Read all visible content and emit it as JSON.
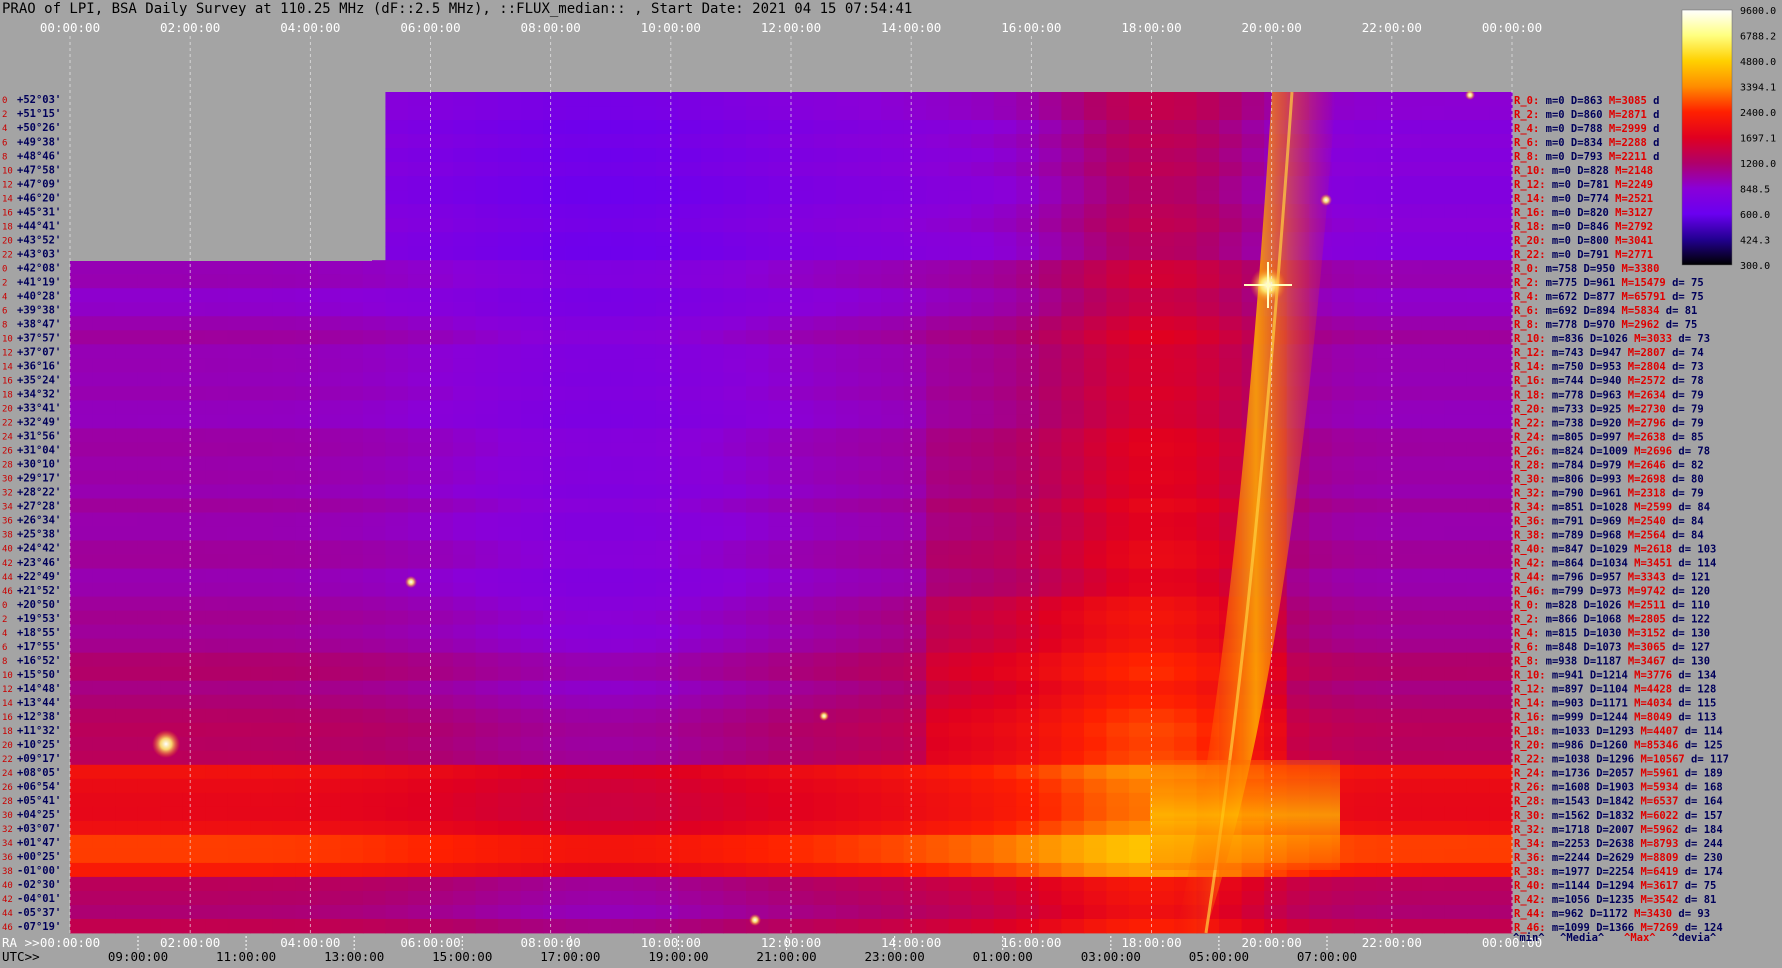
{
  "title": "PRAO of LPI, BSA Daily Survey at 110.25 MHz (dF::2.5 MHz), ::FLUX_median:: , Start Date: 2021 04 15 07:54:41",
  "chart_data": {
    "type": "heatmap",
    "x_top_ticks": [
      "00:00:00",
      "02:00:00",
      "04:00:00",
      "06:00:00",
      "08:00:00",
      "10:00:00",
      "12:00:00",
      "14:00:00",
      "16:00:00",
      "18:00:00",
      "20:00:00",
      "22:00:00",
      "00:00:00"
    ],
    "x_bottom_ra_label": "RA >>",
    "x_bottom_ra_ticks": [
      "00:00:00",
      "02:00:00",
      "04:00:00",
      "06:00:00",
      "08:00:00",
      "10:00:00",
      "12:00:00",
      "14:00:00",
      "16:00:00",
      "18:00:00",
      "20:00:00",
      "22:00:00",
      "00:00:00"
    ],
    "x_bottom_utc_label": "UTC>>",
    "x_bottom_utc_ticks": [
      "09:00:00",
      "11:00:00",
      "13:00:00",
      "15:00:00",
      "17:00:00",
      "19:00:00",
      "21:00:00",
      "23:00:00",
      "01:00:00",
      "03:00:00",
      "05:00:00",
      "07:00:00"
    ],
    "colorbar": {
      "ticks": [
        "9600.0",
        "6788.2",
        "4800.0",
        "3394.1",
        "2400.0",
        "1697.1",
        "1200.0",
        "848.5",
        "600.0",
        "424.3",
        "300.0"
      ],
      "colors": [
        "#ffffff",
        "#ffff80",
        "#ffd000",
        "#ff8c00",
        "#ff2000",
        "#e00020",
        "#b0006a",
        "#8a00d8",
        "#6a00f0",
        "#220090",
        "#000000"
      ]
    },
    "rows": [
      {
        "i": "0",
        "dec": "+52°03'",
        "r": "R_0:",
        "m": "0",
        "d": "863",
        "mx": "3085",
        "dev": "d"
      },
      {
        "i": "2",
        "dec": "+51°15'",
        "r": "R_2:",
        "m": "0",
        "d": "860",
        "mx": "2871",
        "dev": "d"
      },
      {
        "i": "4",
        "dec": "+50°26'",
        "r": "R_4:",
        "m": "0",
        "d": "788",
        "mx": "2999",
        "dev": "d"
      },
      {
        "i": "6",
        "dec": "+49°38'",
        "r": "R_6:",
        "m": "0",
        "d": "834",
        "mx": "2288",
        "dev": "d"
      },
      {
        "i": "8",
        "dec": "+48°46'",
        "r": "R_8:",
        "m": "0",
        "d": "793",
        "mx": "2211",
        "dev": "d"
      },
      {
        "i": "10",
        "dec": "+47°58'",
        "r": "R_10:",
        "m": "0",
        "d": "828",
        "mx": "2148",
        "dev": ""
      },
      {
        "i": "12",
        "dec": "+47°09'",
        "r": "R_12:",
        "m": "0",
        "d": "781",
        "mx": "2249",
        "dev": ""
      },
      {
        "i": "14",
        "dec": "+46°20'",
        "r": "R_14:",
        "m": "0",
        "d": "774",
        "mx": "2521",
        "dev": ""
      },
      {
        "i": "16",
        "dec": "+45°31'",
        "r": "R_16:",
        "m": "0",
        "d": "820",
        "mx": "3127",
        "dev": ""
      },
      {
        "i": "18",
        "dec": "+44°41'",
        "r": "R_18:",
        "m": "0",
        "d": "846",
        "mx": "2792",
        "dev": ""
      },
      {
        "i": "20",
        "dec": "+43°52'",
        "r": "R_20:",
        "m": "0",
        "d": "800",
        "mx": "3041",
        "dev": ""
      },
      {
        "i": "22",
        "dec": "+43°03'",
        "r": "R_22:",
        "m": "0",
        "d": "791",
        "mx": "2771",
        "dev": ""
      },
      {
        "i": "0",
        "dec": "+42°08'",
        "r": "R_0:",
        "m": "758",
        "d": "950",
        "mx": "3380",
        "dev": ""
      },
      {
        "i": "2",
        "dec": "+41°19'",
        "r": "R_2:",
        "m": "775",
        "d": "961",
        "mx": "15479",
        "dev": "75"
      },
      {
        "i": "4",
        "dec": "+40°28'",
        "r": "R_4:",
        "m": "672",
        "d": "877",
        "mx": "65791",
        "dev": "75"
      },
      {
        "i": "6",
        "dec": "+39°38'",
        "r": "R_6:",
        "m": "692",
        "d": "894",
        "mx": "5834",
        "dev": "81"
      },
      {
        "i": "8",
        "dec": "+38°47'",
        "r": "R_8:",
        "m": "778",
        "d": "970",
        "mx": "2962",
        "dev": "75"
      },
      {
        "i": "10",
        "dec": "+37°57'",
        "r": "R_10:",
        "m": "836",
        "d": "1026",
        "mx": "3033",
        "dev": "73"
      },
      {
        "i": "12",
        "dec": "+37°07'",
        "r": "R_12:",
        "m": "743",
        "d": "947",
        "mx": "2807",
        "dev": "74"
      },
      {
        "i": "14",
        "dec": "+36°16'",
        "r": "R_14:",
        "m": "750",
        "d": "953",
        "mx": "2804",
        "dev": "73"
      },
      {
        "i": "16",
        "dec": "+35°24'",
        "r": "R_16:",
        "m": "744",
        "d": "940",
        "mx": "2572",
        "dev": "78"
      },
      {
        "i": "18",
        "dec": "+34°32'",
        "r": "R_18:",
        "m": "778",
        "d": "963",
        "mx": "2634",
        "dev": "79"
      },
      {
        "i": "20",
        "dec": "+33°41'",
        "r": "R_20:",
        "m": "733",
        "d": "925",
        "mx": "2730",
        "dev": "79"
      },
      {
        "i": "22",
        "dec": "+32°49'",
        "r": "R_22:",
        "m": "738",
        "d": "920",
        "mx": "2796",
        "dev": "79"
      },
      {
        "i": "24",
        "dec": "+31°56'",
        "r": "R_24:",
        "m": "805",
        "d": "997",
        "mx": "2638",
        "dev": "85"
      },
      {
        "i": "26",
        "dec": "+31°04'",
        "r": "R_26:",
        "m": "824",
        "d": "1009",
        "mx": "2696",
        "dev": "78"
      },
      {
        "i": "28",
        "dec": "+30°10'",
        "r": "R_28:",
        "m": "784",
        "d": "979",
        "mx": "2646",
        "dev": "82"
      },
      {
        "i": "30",
        "dec": "+29°17'",
        "r": "R_30:",
        "m": "806",
        "d": "993",
        "mx": "2698",
        "dev": "80"
      },
      {
        "i": "32",
        "dec": "+28°22'",
        "r": "R_32:",
        "m": "790",
        "d": "961",
        "mx": "2318",
        "dev": "79"
      },
      {
        "i": "34",
        "dec": "+27°28'",
        "r": "R_34:",
        "m": "851",
        "d": "1028",
        "mx": "2599",
        "dev": "84"
      },
      {
        "i": "36",
        "dec": "+26°34'",
        "r": "R_36:",
        "m": "791",
        "d": "969",
        "mx": "2540",
        "dev": "84"
      },
      {
        "i": "38",
        "dec": "+25°38'",
        "r": "R_38:",
        "m": "789",
        "d": "968",
        "mx": "2564",
        "dev": "84"
      },
      {
        "i": "40",
        "dec": "+24°42'",
        "r": "R_40:",
        "m": "847",
        "d": "1029",
        "mx": "2618",
        "dev": "103"
      },
      {
        "i": "42",
        "dec": "+23°46'",
        "r": "R_42:",
        "m": "864",
        "d": "1034",
        "mx": "3451",
        "dev": "114"
      },
      {
        "i": "44",
        "dec": "+22°49'",
        "r": "R_44:",
        "m": "796",
        "d": "957",
        "mx": "3343",
        "dev": "121"
      },
      {
        "i": "46",
        "dec": "+21°52'",
        "r": "R_46:",
        "m": "799",
        "d": "973",
        "mx": "9742",
        "dev": "120"
      },
      {
        "i": "0",
        "dec": "+20°50'",
        "r": "R_0:",
        "m": "828",
        "d": "1026",
        "mx": "2511",
        "dev": "110"
      },
      {
        "i": "2",
        "dec": "+19°53'",
        "r": "R_2:",
        "m": "866",
        "d": "1068",
        "mx": "2805",
        "dev": "122"
      },
      {
        "i": "4",
        "dec": "+18°55'",
        "r": "R_4:",
        "m": "815",
        "d": "1030",
        "mx": "3152",
        "dev": "130"
      },
      {
        "i": "6",
        "dec": "+17°55'",
        "r": "R_6:",
        "m": "848",
        "d": "1073",
        "mx": "3065",
        "dev": "127"
      },
      {
        "i": "8",
        "dec": "+16°52'",
        "r": "R_8:",
        "m": "938",
        "d": "1187",
        "mx": "3467",
        "dev": "130"
      },
      {
        "i": "10",
        "dec": "+15°50'",
        "r": "R_10:",
        "m": "941",
        "d": "1214",
        "mx": "3776",
        "dev": "134"
      },
      {
        "i": "12",
        "dec": "+14°48'",
        "r": "R_12:",
        "m": "897",
        "d": "1104",
        "mx": "4428",
        "dev": "128"
      },
      {
        "i": "14",
        "dec": "+13°44'",
        "r": "R_14:",
        "m": "903",
        "d": "1171",
        "mx": "4034",
        "dev": "115"
      },
      {
        "i": "16",
        "dec": "+12°38'",
        "r": "R_16:",
        "m": "999",
        "d": "1244",
        "mx": "8049",
        "dev": "113"
      },
      {
        "i": "18",
        "dec": "+11°32'",
        "r": "R_18:",
        "m": "1033",
        "d": "1293",
        "mx": "4407",
        "dev": "114"
      },
      {
        "i": "20",
        "dec": "+10°25'",
        "r": "R_20:",
        "m": "986",
        "d": "1260",
        "mx": "85346",
        "dev": "125"
      },
      {
        "i": "22",
        "dec": "+09°17'",
        "r": "R_22:",
        "m": "1038",
        "d": "1296",
        "mx": "10567",
        "dev": "117"
      },
      {
        "i": "24",
        "dec": "+08°05'",
        "r": "R_24:",
        "m": "1736",
        "d": "2057",
        "mx": "5961",
        "dev": "189"
      },
      {
        "i": "26",
        "dec": "+06°54'",
        "r": "R_26:",
        "m": "1608",
        "d": "1903",
        "mx": "5934",
        "dev": "168"
      },
      {
        "i": "28",
        "dec": "+05°41'",
        "r": "R_28:",
        "m": "1543",
        "d": "1842",
        "mx": "6537",
        "dev": "164"
      },
      {
        "i": "30",
        "dec": "+04°25'",
        "r": "R_30:",
        "m": "1562",
        "d": "1832",
        "mx": "6022",
        "dev": "157"
      },
      {
        "i": "32",
        "dec": "+03°07'",
        "r": "R_32:",
        "m": "1718",
        "d": "2007",
        "mx": "5962",
        "dev": "184"
      },
      {
        "i": "34",
        "dec": "+01°47'",
        "r": "R_34:",
        "m": "2253",
        "d": "2638",
        "mx": "8793",
        "dev": "244"
      },
      {
        "i": "36",
        "dec": "+00°25'",
        "r": "R_36:",
        "m": "2244",
        "d": "2629",
        "mx": "8809",
        "dev": "230"
      },
      {
        "i": "38",
        "dec": "-01°00'",
        "r": "R_38:",
        "m": "1977",
        "d": "2254",
        "mx": "6419",
        "dev": "174"
      },
      {
        "i": "40",
        "dec": "-02°30'",
        "r": "R_40:",
        "m": "1144",
        "d": "1294",
        "mx": "3617",
        "dev": "75"
      },
      {
        "i": "42",
        "dec": "-04°01'",
        "r": "R_42:",
        "m": "1056",
        "d": "1235",
        "mx": "3542",
        "dev": "81"
      },
      {
        "i": "44",
        "dec": "-05°37'",
        "r": "R_44:",
        "m": "962",
        "d": "1172",
        "mx": "3430",
        "dev": "93"
      },
      {
        "i": "46",
        "dec": "-07°19'",
        "r": "R_46:",
        "m": "1099",
        "d": "1366",
        "mx": "7269",
        "dev": "124"
      }
    ],
    "legend_bottom": {
      "min": "^min^",
      "media": "^Media^",
      "max": "^Max^",
      "devia": "^devia^"
    }
  }
}
